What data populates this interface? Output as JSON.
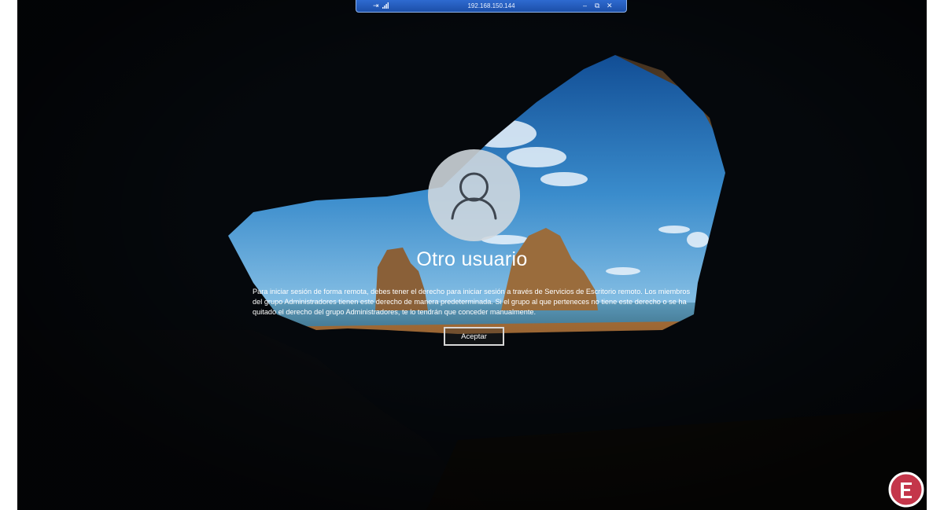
{
  "rdp_bar": {
    "address": "192.168.150.144",
    "pin_icon": "pin-icon",
    "signal_icon": "signal-bars-icon",
    "minimize_icon": "minimize-icon",
    "restore_icon": "restore-icon",
    "close_icon": "close-icon",
    "minimize_glyph": "–",
    "restore_glyph": "⧉",
    "close_glyph": "✕"
  },
  "login": {
    "avatar_icon": "user-avatar-icon",
    "user_name": "Otro usuario",
    "message": "Para iniciar sesión de forma remota, debes tener el derecho para iniciar sesión a través de Servicios de Escritorio remoto. Los miembros del grupo Administradores tienen este derecho de manera predeterminada. Si el grupo al que perteneces no tiene este derecho o se ha quitado el derecho del grupo Administradores, te lo tendrán que conceder manualmente.",
    "accept_label": "Aceptar"
  },
  "watermark": {
    "icon": "site-logo-icon"
  },
  "colors": {
    "rdp_bar": "#1c4fa8",
    "sky": "#2a6fb4",
    "sand": "#8a5a2a",
    "cave": "#05080c"
  }
}
